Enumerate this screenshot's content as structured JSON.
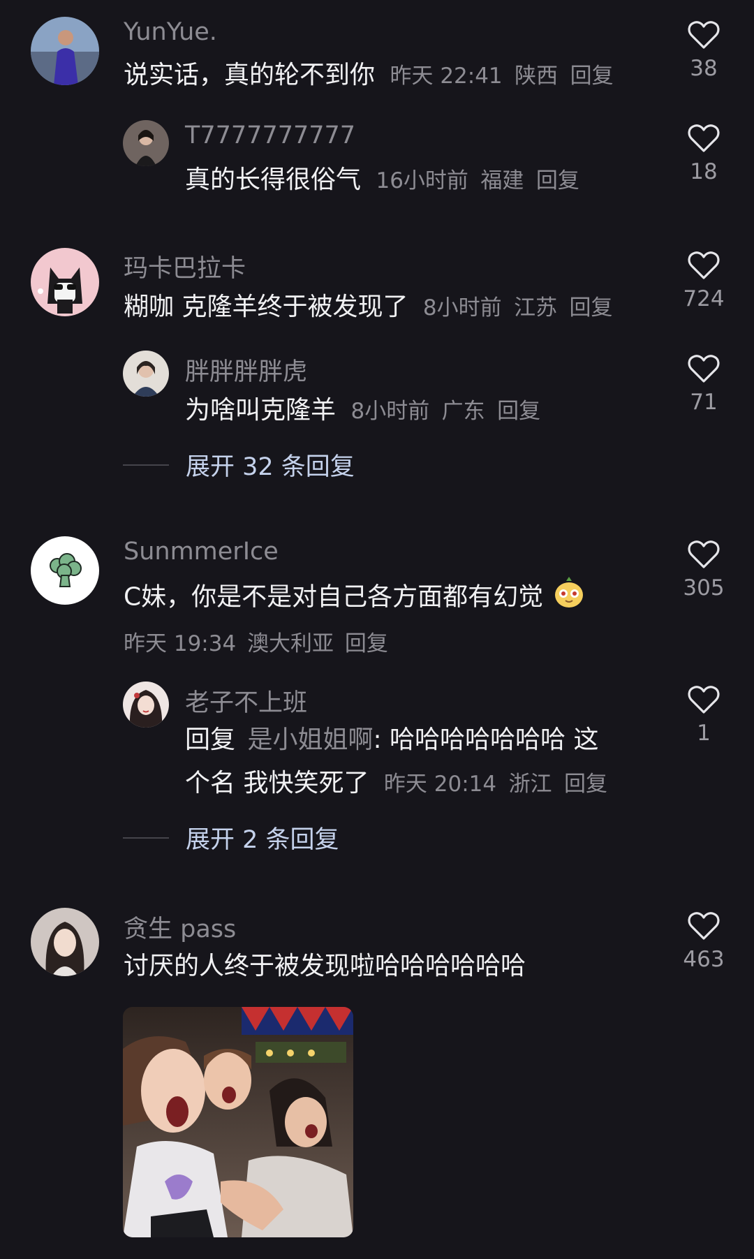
{
  "comments": [
    {
      "username": "YunYue.",
      "text": "说实话，真的轮不到你",
      "time": "昨天 22:41",
      "location": "陕西",
      "reply_label": "回复",
      "likes": "38",
      "replies": [
        {
          "username": "T7777777777",
          "text": "真的长得很俗气",
          "time": "16小时前",
          "location": "福建",
          "reply_label": "回复",
          "likes": "18"
        }
      ]
    },
    {
      "username": "玛卡巴拉卡",
      "text": "糊咖 克隆羊终于被发现了",
      "time": "8小时前",
      "location": "江苏",
      "reply_label": "回复",
      "likes": "724",
      "replies": [
        {
          "username": "胖胖胖胖虎",
          "text": "为啥叫克隆羊",
          "time": "8小时前",
          "location": "广东",
          "reply_label": "回复",
          "likes": "71"
        }
      ],
      "expand_label": "展开 32 条回复"
    },
    {
      "username": "SunmmerIce",
      "text": "C妹，你是不是对自己各方面都有幻觉",
      "time": "昨天 19:34",
      "location": "澳大利亚",
      "reply_label": "回复",
      "likes": "305",
      "replies": [
        {
          "username": "老子不上班",
          "reply_prefix": "回复",
          "mention": "是小姐姐啊",
          "text_line1": ": 哈哈哈哈哈哈哈 这",
          "text_line2": "个名 我快笑死了",
          "time": "昨天 20:14",
          "location": "浙江",
          "reply_label": "回复",
          "likes": "1"
        }
      ],
      "expand_label": "展开 2 条回复"
    },
    {
      "username": "贪生 pass",
      "text": "讨厌的人终于被发现啦哈哈哈哈哈哈",
      "likes": "463"
    }
  ],
  "colors": {
    "background": "#16151b",
    "primary_text": "#f1f1f3",
    "secondary_text": "#8d8c93",
    "expand_text": "#c5d2ec"
  },
  "icons": {
    "like": "heart-outline-icon",
    "emoji": "pear-face-emoji"
  }
}
